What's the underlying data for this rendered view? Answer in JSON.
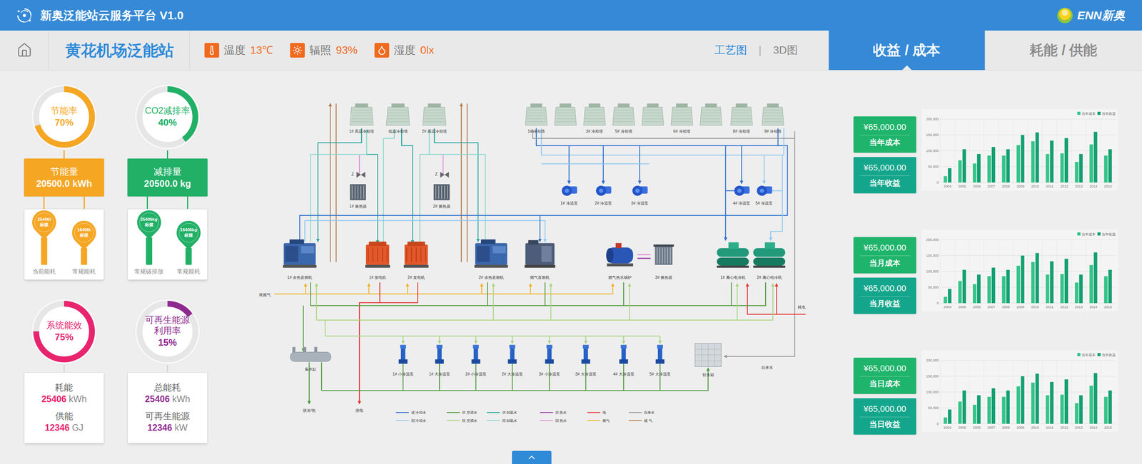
{
  "header": {
    "title": "新奥泛能站云服务平台 V1.0",
    "brand": "ENN新奥"
  },
  "subheader": {
    "station": "黄花机场泛能站",
    "weather": [
      {
        "label": "温度",
        "value": "13℃"
      },
      {
        "label": "辐照",
        "value": "93%"
      },
      {
        "label": "湿度",
        "value": "0lx"
      }
    ],
    "views": [
      {
        "label": "工艺图",
        "selected": true
      },
      {
        "label": "3D图",
        "selected": false
      }
    ],
    "view_separator": "|",
    "tabs": [
      {
        "label": "收益 / 成本",
        "selected": true
      },
      {
        "label": "耗能 / 供能",
        "selected": false
      }
    ]
  },
  "kpis": [
    {
      "kind": "pins",
      "title": "节能率",
      "value": "70%",
      "level": 0.7,
      "color": "#f5a623",
      "box": {
        "label": "节能量",
        "value": "20500.0 kWh"
      },
      "pins": [
        {
          "value": "25406t",
          "unit": "标煤",
          "caption": "当前能耗",
          "level": 0.85
        },
        {
          "value": "16406t",
          "unit": "标煤",
          "caption": "常规能耗",
          "level": 0.4
        }
      ]
    },
    {
      "kind": "pins",
      "title": "CO2减排率",
      "value": "40%",
      "level": 0.4,
      "color": "#21b066",
      "box": {
        "label": "减排量",
        "value": "20500.0 kg"
      },
      "pins": [
        {
          "value": "25406kg",
          "unit": "标煤",
          "caption": "常规碳排放",
          "level": 0.85
        },
        {
          "value": "16406kg",
          "unit": "标煤",
          "caption": "常规能耗",
          "level": 0.4
        }
      ]
    },
    {
      "kind": "stats",
      "title": "系统能效",
      "value": "75%",
      "level": 0.75,
      "color": "#e8246f",
      "stats": [
        {
          "label": "耗能",
          "value": "25406",
          "unit": "kWh"
        },
        {
          "label": "供能",
          "value": "12346",
          "unit": "GJ"
        }
      ]
    },
    {
      "kind": "stats",
      "title": "可再生能源利用率",
      "value": "15%",
      "level": 0.15,
      "color": "#8e2a8e",
      "stats": [
        {
          "label": "总能耗",
          "value": "25406",
          "unit": "kWh"
        },
        {
          "label": "可再生能源",
          "value": "12346",
          "unit": "kW"
        }
      ]
    }
  ],
  "diagram": {
    "high_towers": [
      {
        "label": "1# 高温冷却塔"
      },
      {
        "label": "低温冷却塔"
      },
      {
        "label": "2# 高温冷却塔"
      }
    ],
    "cooling_towers": [
      {
        "label": "1# 冷却塔"
      },
      {
        "label": ""
      },
      {
        "label": "3# 冷却塔"
      },
      {
        "label": "5# 冷却塔"
      },
      {
        "label": ""
      },
      {
        "label": "6# 冷却塔"
      },
      {
        "label": ""
      },
      {
        "label": "8# 冷却塔"
      },
      {
        "label": "9# 冷却塔"
      }
    ],
    "exchangers": [
      {
        "label": "1# 换热器",
        "mark": "Z"
      },
      {
        "label": "2# 换热器",
        "mark": "Z"
      }
    ],
    "pumps": [
      {
        "label": "1# 冷温泵"
      },
      {
        "label": "2# 冷温泵"
      },
      {
        "label": "3# 冷温泵"
      },
      {
        "label": "4# 冷温泵"
      },
      {
        "label": "5# 冷温泵"
      }
    ],
    "equipment": [
      {
        "label": "1# 余热直燃机",
        "kind": "absorption"
      },
      {
        "label": "1# 发电机",
        "kind": "generator"
      },
      {
        "label": "2# 发电机",
        "kind": "generator"
      },
      {
        "label": "2# 余热直燃机",
        "kind": "absorption"
      },
      {
        "label": "燃气直燃机",
        "kind": "direct"
      },
      {
        "label": "燃气热水锅炉",
        "kind": "boiler"
      },
      {
        "label": "3# 换热器",
        "kind": "exchanger"
      },
      {
        "label": "1# 离心电冷机",
        "kind": "chiller"
      },
      {
        "label": "2# 离心电冷机",
        "kind": "chiller"
      }
    ],
    "bottom_pumps": [
      {
        "label": "1# 小冷温泵"
      },
      {
        "label": "1# 大冷温泵"
      },
      {
        "label": "2# 小冷温泵"
      },
      {
        "label": "2# 大冷温泵"
      },
      {
        "label": "3# 小冷温泵"
      },
      {
        "label": "3# 大冷温泵"
      },
      {
        "label": "4# 大冷温泵"
      },
      {
        "label": "5# 大冷温泵"
      }
    ],
    "labels": {
      "fuel_in": "耗燃气",
      "power_in": "耗电",
      "collector": "集水缸",
      "supply_heat": "供冷/热",
      "supply_power": "供电",
      "tap_water": "自来水",
      "tank": "软水箱"
    },
    "legend": [
      {
        "label": "进 冷却水",
        "color": "#2e6fd0"
      },
      {
        "label": "回 冷却水",
        "color": "#8fc9f2"
      },
      {
        "label": "供 空调水",
        "color": "#4c9a3a"
      },
      {
        "label": "回 空调水",
        "color": "#a9d57f"
      },
      {
        "label": "供 卸载水",
        "color": "#25a79b"
      },
      {
        "label": "回 卸载水",
        "color": "#86d8cd"
      },
      {
        "label": "供 热水",
        "color": "#9b3aa7"
      },
      {
        "label": "回 热水",
        "color": "#e48bdc"
      },
      {
        "label": "电",
        "color": "#e53434"
      },
      {
        "label": "燃气",
        "color": "#f2b22a"
      },
      {
        "label": "自来水",
        "color": "#999999"
      },
      {
        "label": "烟 气",
        "color": "#b67a48"
      }
    ]
  },
  "finance": [
    {
      "cards": [
        {
          "amount": "¥65,000.00",
          "label": "当年成本",
          "color": "#1fb46b"
        },
        {
          "amount": "¥65,000.00",
          "label": "当年收益",
          "color": "#14a68c"
        }
      ],
      "chart": {
        "legend": [
          {
            "label": "当年成本",
            "color": "#35c48a"
          },
          {
            "label": "当年收益",
            "color": "#13a071"
          }
        ],
        "y_ticks": [
          "200,000",
          "150,000",
          "100,000",
          "50,000",
          "0"
        ],
        "x_labels": [
          "2004",
          "2005",
          "2006",
          "2007",
          "2008",
          "2009",
          "2010",
          "2011",
          "2012",
          "2013",
          "2014",
          "2015"
        ],
        "series": [
          [
            20000,
            70000,
            60000,
            85000,
            85000,
            118000,
            130000,
            90000,
            92000,
            65000,
            120000,
            85000
          ],
          [
            45000,
            105000,
            90000,
            112000,
            105000,
            150000,
            158000,
            132000,
            140000,
            90000,
            160000,
            105000
          ]
        ]
      }
    },
    {
      "cards": [
        {
          "amount": "¥65,000.00",
          "label": "当月成本",
          "color": "#1fb46b"
        },
        {
          "amount": "¥65,000.00",
          "label": "当月收益",
          "color": "#14a68c"
        }
      ],
      "chart": {
        "legend": [
          {
            "label": "当年成本",
            "color": "#35c48a"
          },
          {
            "label": "当年收益",
            "color": "#13a071"
          }
        ],
        "y_ticks": [
          "200,000",
          "150,000",
          "100,000",
          "50,000",
          "0"
        ],
        "x_labels": [
          "2004",
          "2005",
          "2006",
          "2007",
          "2008",
          "2009",
          "2010",
          "2011",
          "2012",
          "2013",
          "2014",
          "2015"
        ],
        "series": [
          [
            20000,
            70000,
            60000,
            85000,
            85000,
            118000,
            130000,
            90000,
            92000,
            65000,
            120000,
            85000
          ],
          [
            45000,
            105000,
            90000,
            112000,
            105000,
            150000,
            158000,
            132000,
            140000,
            90000,
            160000,
            105000
          ]
        ]
      }
    },
    {
      "cards": [
        {
          "amount": "¥65,000.00",
          "label": "当日成本",
          "color": "#1fb46b"
        },
        {
          "amount": "¥65,000.00",
          "label": "当日收益",
          "color": "#14a68c"
        }
      ],
      "chart": {
        "legend": [
          {
            "label": "当年成本",
            "color": "#35c48a"
          },
          {
            "label": "当年收益",
            "color": "#13a071"
          }
        ],
        "y_ticks": [
          "200,000",
          "150,000",
          "100,000",
          "50,000",
          "0"
        ],
        "x_labels": [
          "2004",
          "2005",
          "2006",
          "2007",
          "2008",
          "2009",
          "2010",
          "2011",
          "2012",
          "2013",
          "2014",
          "2015"
        ],
        "series": [
          [
            20000,
            70000,
            60000,
            85000,
            85000,
            118000,
            130000,
            90000,
            92000,
            65000,
            120000,
            85000
          ],
          [
            45000,
            105000,
            90000,
            112000,
            105000,
            150000,
            158000,
            132000,
            140000,
            90000,
            160000,
            105000
          ]
        ]
      }
    }
  ]
}
